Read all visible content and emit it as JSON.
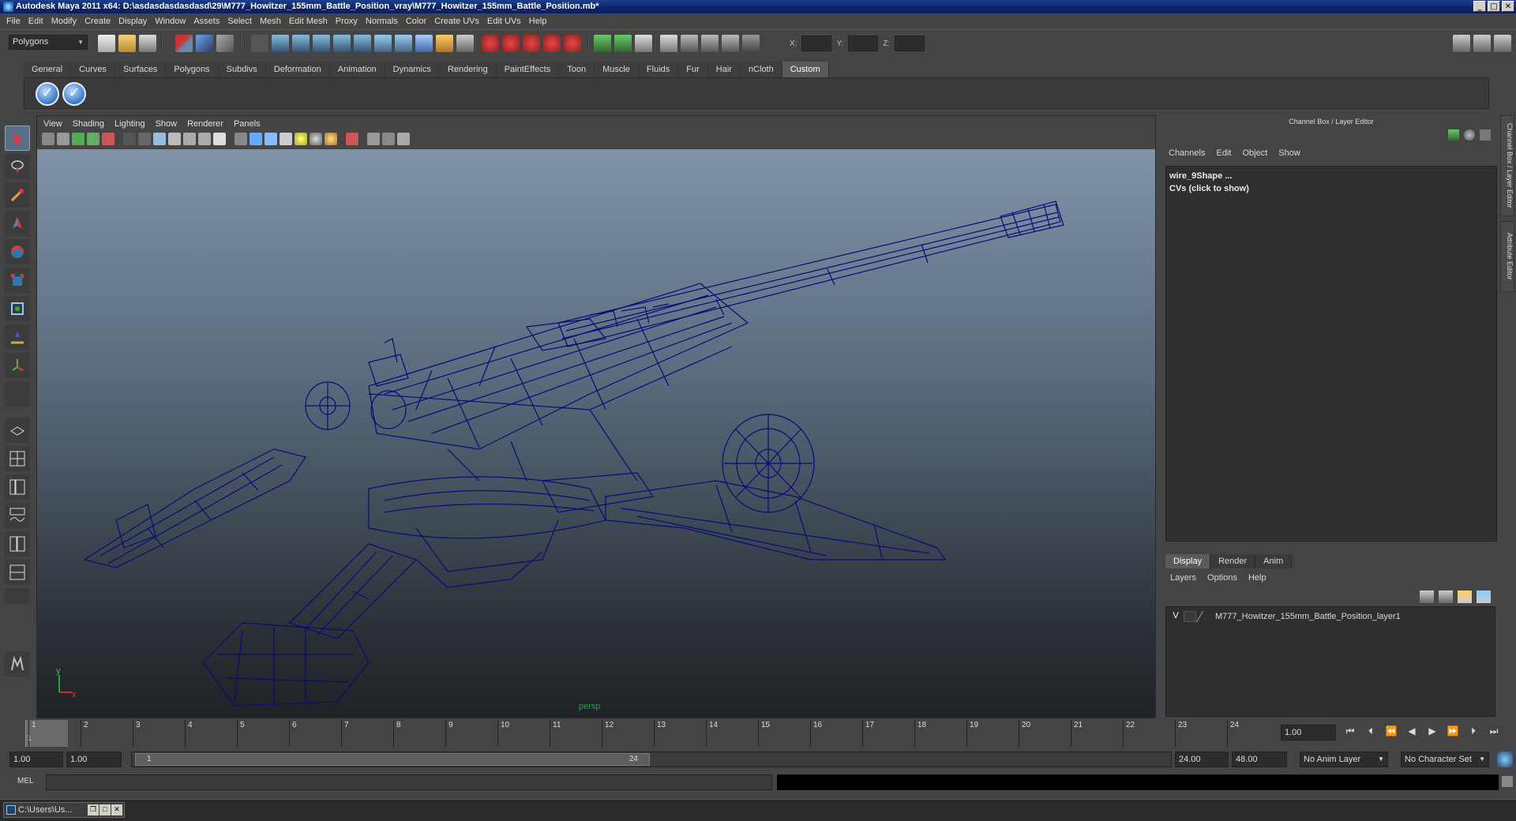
{
  "window": {
    "title": "Autodesk Maya 2011 x64: D:\\asdasdasdasdasd\\29\\M777_Howitzer_155mm_Battle_Position_vray\\M777_Howitzer_155mm_Battle_Position.mb*",
    "buttons": [
      "_",
      "□",
      "✕"
    ]
  },
  "menubar": [
    "File",
    "Edit",
    "Modify",
    "Create",
    "Display",
    "Window",
    "Assets",
    "Select",
    "Mesh",
    "Edit Mesh",
    "Proxy",
    "Normals",
    "Color",
    "Create UVs",
    "Edit UVs",
    "Help"
  ],
  "status_line": {
    "mode": "Polygons",
    "coord_labels": [
      "X:",
      "Y:",
      "Z:"
    ]
  },
  "shelf": {
    "tabs": [
      "General",
      "Curves",
      "Surfaces",
      "Polygons",
      "Subdivs",
      "Deformation",
      "Animation",
      "Dynamics",
      "Rendering",
      "PaintEffects",
      "Toon",
      "Muscle",
      "Fluids",
      "Fur",
      "Hair",
      "nCloth",
      "Custom"
    ],
    "active_tab": "Custom"
  },
  "viewport": {
    "menu": [
      "View",
      "Shading",
      "Lighting",
      "Show",
      "Renderer",
      "Panels"
    ],
    "camera_label": "persp",
    "axis_y": "y",
    "axis_x": "x",
    "wireframe_color": "#0a0a78"
  },
  "channel_box": {
    "title": "Channel Box / Layer Editor",
    "menu": [
      "Channels",
      "Edit",
      "Object",
      "Show"
    ],
    "object_name": "wire_9Shape ...",
    "cvs_label": "CVs (click to show)"
  },
  "side_tabs": [
    "Channel Box / Layer Editor",
    "Attribute Editor"
  ],
  "layer_editor": {
    "tabs": [
      "Display",
      "Render",
      "Anim"
    ],
    "active_tab": "Display",
    "menu": [
      "Layers",
      "Options",
      "Help"
    ],
    "layers": [
      {
        "visible": "V",
        "name": "M777_Howitzer_155mm_Battle_Position_layer1"
      }
    ]
  },
  "time_slider": {
    "ticks": [
      "1",
      "2",
      "3",
      "4",
      "5",
      "6",
      "7",
      "8",
      "9",
      "10",
      "11",
      "12",
      "13",
      "14",
      "15",
      "16",
      "17",
      "18",
      "19",
      "20",
      "21",
      "22",
      "23",
      "24"
    ],
    "current_frame_label": "1",
    "current_frame": "1.00"
  },
  "range_slider": {
    "start": "1.00",
    "playback_start": "1.00",
    "handle_start": "1",
    "handle_end": "24",
    "playback_end": "24.00",
    "end": "48.00",
    "anim_layer": "No Anim Layer",
    "character_set": "No Character Set"
  },
  "command_line": {
    "label": "MEL"
  },
  "taskbar": {
    "item": "C:\\Users\\Us..."
  }
}
